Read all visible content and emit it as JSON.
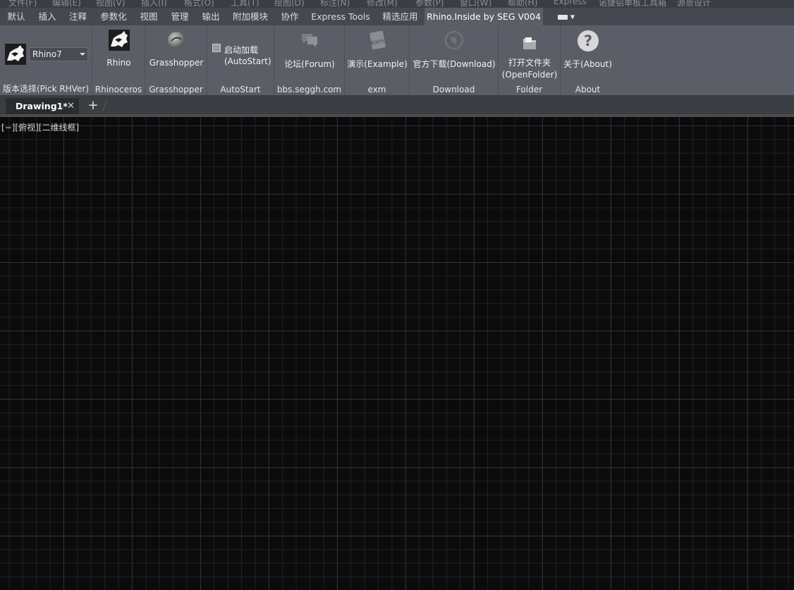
{
  "menubar": {
    "items": [
      "文件(F)",
      "编辑(E)",
      "视图(V)",
      "插入(I)",
      "格式(O)",
      "工具(T)",
      "绘图(D)",
      "标注(N)",
      "修改(M)",
      "参数(P)",
      "窗口(W)",
      "帮助(H)",
      "Express",
      "诺捷铝单板工具箱",
      "源景设计"
    ]
  },
  "ribbon_tabs": {
    "items": [
      "默认",
      "插入",
      "注释",
      "参数化",
      "视图",
      "管理",
      "输出",
      "附加模块",
      "协作",
      "Express Tools",
      "精选应用",
      "Rhino.Inside by SEG V004"
    ],
    "active": "Rhino.Inside by SEG V004",
    "dropdown_icon": "window-dropdown-icon"
  },
  "panels": {
    "version": {
      "title": "版本选择(Pick RHVer)",
      "combo_value": "Rhino7",
      "icon": "rhino-logo-icon"
    },
    "rhinoceros": {
      "title": "Rhinoceros",
      "button_label": "Rhino",
      "icon": "rhino-logo-icon"
    },
    "grasshopper": {
      "title": "Grasshopper",
      "button_label": "Grasshopper",
      "icon": "grasshopper-sphere-icon"
    },
    "autostart": {
      "title": "AutoStart",
      "label_line1": "启动加载",
      "label_line2": "(AutoStart)",
      "checked": false
    },
    "forum": {
      "title": "bbs.seggh.com",
      "button_label": "论坛(Forum)",
      "icon": "chat-bubble-icon"
    },
    "example": {
      "title": "exm",
      "button_label": "演示(Example)",
      "icon": "example-document-icon"
    },
    "download": {
      "title": "Download",
      "button_label": "官方下载(Download)",
      "icon": "download-globe-icon"
    },
    "folder": {
      "title": "Folder",
      "label_line1": "打开文件夹",
      "label_line2": "(OpenFolder)",
      "icon": "folder-icon"
    },
    "about": {
      "title": "About",
      "button_label": "关于(About)",
      "icon": "help-question-icon"
    }
  },
  "document_tabs": {
    "active_tab": "Drawing1*",
    "close_glyph": "✕",
    "add_glyph": "+"
  },
  "viewport": {
    "label": "[−][俯视][二维线框]"
  },
  "colors": {
    "ribbon_bg": "#5b5e66",
    "tabbar_bg": "#454850",
    "canvas_bg": "#0b0b0b",
    "grid_major": "#3e4248"
  }
}
